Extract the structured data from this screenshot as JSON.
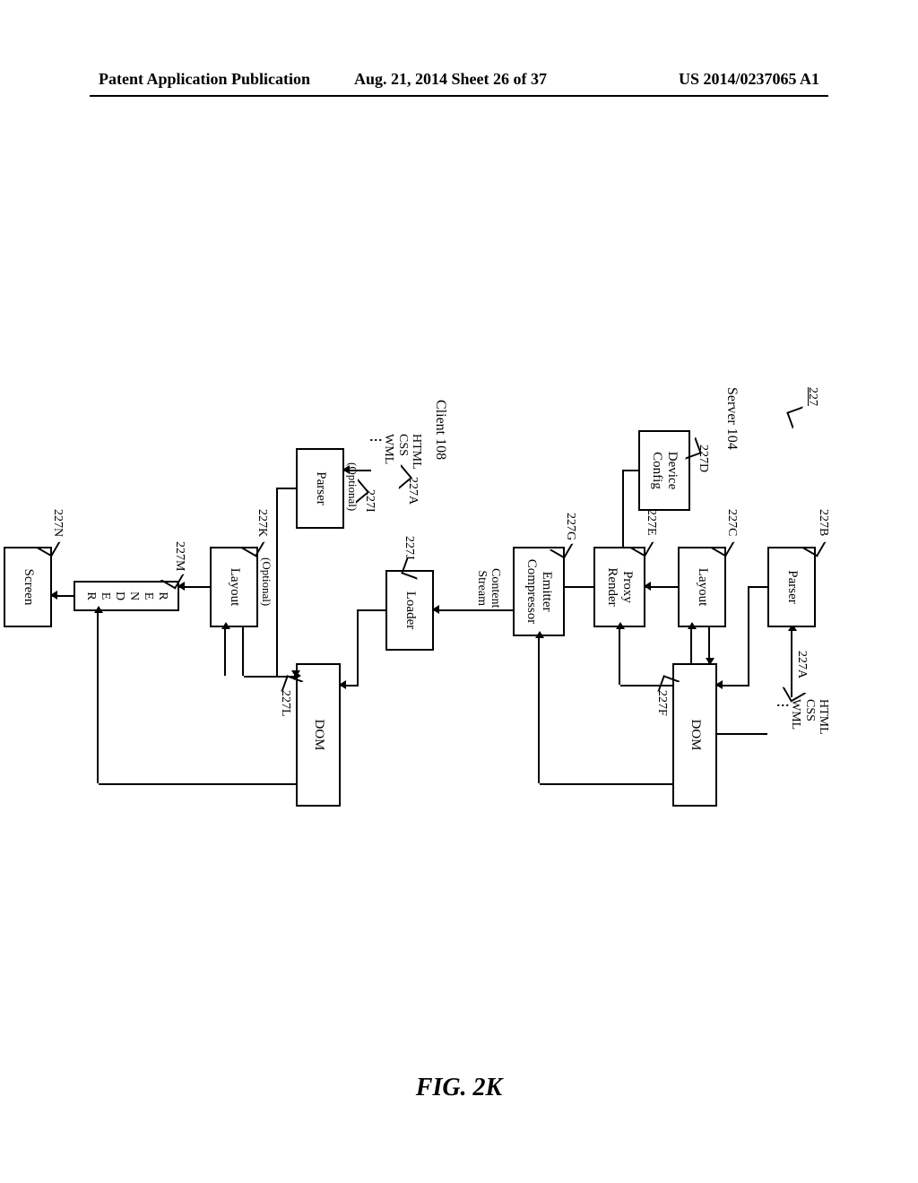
{
  "header": {
    "left": "Patent Application Publication",
    "center": "Aug. 21, 2014  Sheet 26 of 37",
    "right": "US 2014/0237065 A1"
  },
  "figure": {
    "caption": "FIG. 2K",
    "group_ref": "227",
    "server_label": "Server 104",
    "client_label": "Client 108"
  },
  "blocks": {
    "input_server": {
      "l1": "HTML",
      "l2": "CSS",
      "l3": "WML",
      "ref": "227A"
    },
    "parser_server": {
      "label": "Parser",
      "ref": "227B"
    },
    "layout_server": {
      "label": "Layout",
      "ref": "227C"
    },
    "device_config": {
      "l1": "Device",
      "l2": "Config",
      "ref": "227D"
    },
    "proxy_render": {
      "l1": "Proxy",
      "l2": "Render",
      "ref": "227E"
    },
    "dom_server": {
      "label": "DOM",
      "ref": "227F"
    },
    "emitter": {
      "l1": "Emitter",
      "l2": "Compressor",
      "ref": "227G"
    },
    "content_stream": {
      "l1": "Content",
      "l2": "Stream"
    },
    "input_client": {
      "l1": "HTML",
      "l2": "CSS",
      "l3": "WML",
      "ref": "227A"
    },
    "parser_client": {
      "label": "Parser",
      "ref": "227I",
      "note": "(Optional)"
    },
    "loader": {
      "label": "Loader",
      "ref": "227J"
    },
    "layout_client": {
      "label": "Layout",
      "ref": "227K",
      "note": "(Optional)"
    },
    "dom_client": {
      "label": "DOM",
      "ref": "227L"
    },
    "render": {
      "label": "RENDER",
      "ref": "227M"
    },
    "screen": {
      "label": "Screen",
      "ref": "227N"
    }
  }
}
